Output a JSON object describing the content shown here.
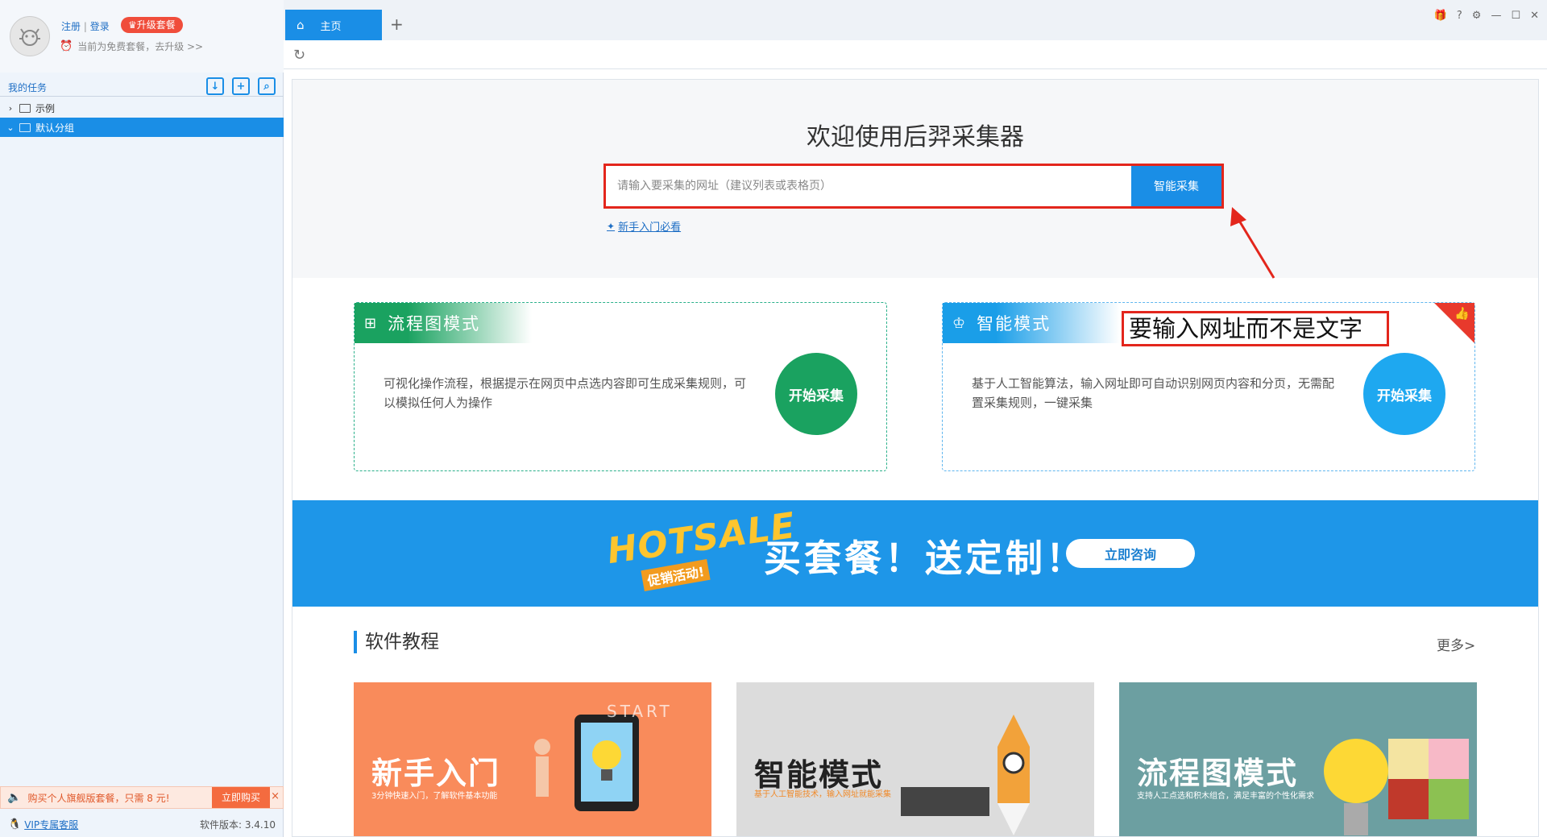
{
  "user": {
    "register": "注册",
    "separator": "|",
    "login": "登录",
    "upgrade_label": "升级套餐",
    "plan_text": "当前为免费套餐，去升级 >>"
  },
  "tasks": {
    "title": "我的任务",
    "folders": [
      {
        "label": "示例",
        "expanded": false,
        "selected": false
      },
      {
        "label": "默认分组",
        "expanded": true,
        "selected": true
      }
    ]
  },
  "promo": {
    "text": "购买个人旗舰版套餐，只需 8 元!",
    "button": "立即购买",
    "close": "×"
  },
  "status": {
    "vip": "VIP专属客服",
    "version": "软件版本: 3.4.10"
  },
  "tabs": {
    "home_label": "主页",
    "add": "+"
  },
  "hero": {
    "welcome": "欢迎使用后羿采集器",
    "search_placeholder": "请输入要采集的网址（建议列表或表格页）",
    "search_button": "智能采集",
    "guide_link": "新手入门必看"
  },
  "modes": {
    "flow": {
      "title": "流程图模式",
      "desc": "可视化操作流程，根据提示在网页中点选内容即可生成采集规则，可以模拟任何人为操作",
      "button": "开始采集"
    },
    "smart": {
      "title": "智能模式",
      "desc": "基于人工智能算法，输入网址即可自动识别网页内容和分页，无需配置采集规则，一键采集",
      "button": "开始采集",
      "annotation": "要输入网址而不是文字"
    }
  },
  "banner": {
    "hot": "HOTSALE",
    "sub": "促销活动!",
    "main": "买套餐！送定制！",
    "button": "立即咨询"
  },
  "tutorials": {
    "title": "软件教程",
    "more": "更多>",
    "cards": [
      {
        "title": "新手入门",
        "sub": "3分钟快速入门，了解软件基本功能",
        "art_text": "START"
      },
      {
        "title": "智能模式",
        "sub": "基于人工智能技术，输入网址就能采集"
      },
      {
        "title": "流程图模式",
        "sub": "支持人工点选和积木组合，满足丰富的个性化需求"
      }
    ]
  },
  "colors": {
    "primary": "#1a8ee6",
    "green": "#1aa260",
    "red": "#e3261c",
    "orange": "#f98b5b"
  }
}
